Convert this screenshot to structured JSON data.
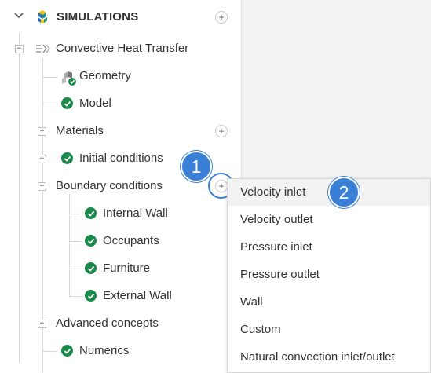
{
  "header": {
    "title": "SIMULATIONS",
    "add_label": "+"
  },
  "tree": {
    "root": {
      "label": "Convective Heat Transfer",
      "toggle": "−"
    },
    "geometry": {
      "label": "Geometry"
    },
    "model": {
      "label": "Model"
    },
    "materials": {
      "label": "Materials",
      "toggle": "+",
      "add_label": "+"
    },
    "initial_conditions": {
      "label": "Initial conditions",
      "toggle": "+"
    },
    "boundary_conditions": {
      "label": "Boundary conditions",
      "toggle": "−",
      "add_label": "+"
    },
    "boundary_children": [
      {
        "label": "Internal Wall"
      },
      {
        "label": "Occupants"
      },
      {
        "label": "Furniture"
      },
      {
        "label": "External Wall"
      }
    ],
    "advanced_concepts": {
      "label": "Advanced concepts",
      "toggle": "+"
    },
    "numerics": {
      "label": "Numerics"
    }
  },
  "callouts": {
    "step1": "1",
    "step2": "2"
  },
  "context_menu": {
    "items": [
      {
        "label": "Velocity inlet"
      },
      {
        "label": "Velocity outlet"
      },
      {
        "label": "Pressure inlet"
      },
      {
        "label": "Pressure outlet"
      },
      {
        "label": "Wall"
      },
      {
        "label": "Custom"
      },
      {
        "label": "Natural convection inlet/outlet"
      }
    ]
  },
  "colors": {
    "check_green": "#1a8a4a",
    "callout_blue": "#3a7fd6",
    "panel_bg": "#ffffff",
    "page_bg": "#f3f3f3"
  },
  "icons": {
    "chevron": "chevron-down-icon",
    "logo": "cube-stack-icon",
    "geometry": "geometry-cubes-icon",
    "sim_type": "heat-flow-icon",
    "status": "check-circle-icon"
  }
}
